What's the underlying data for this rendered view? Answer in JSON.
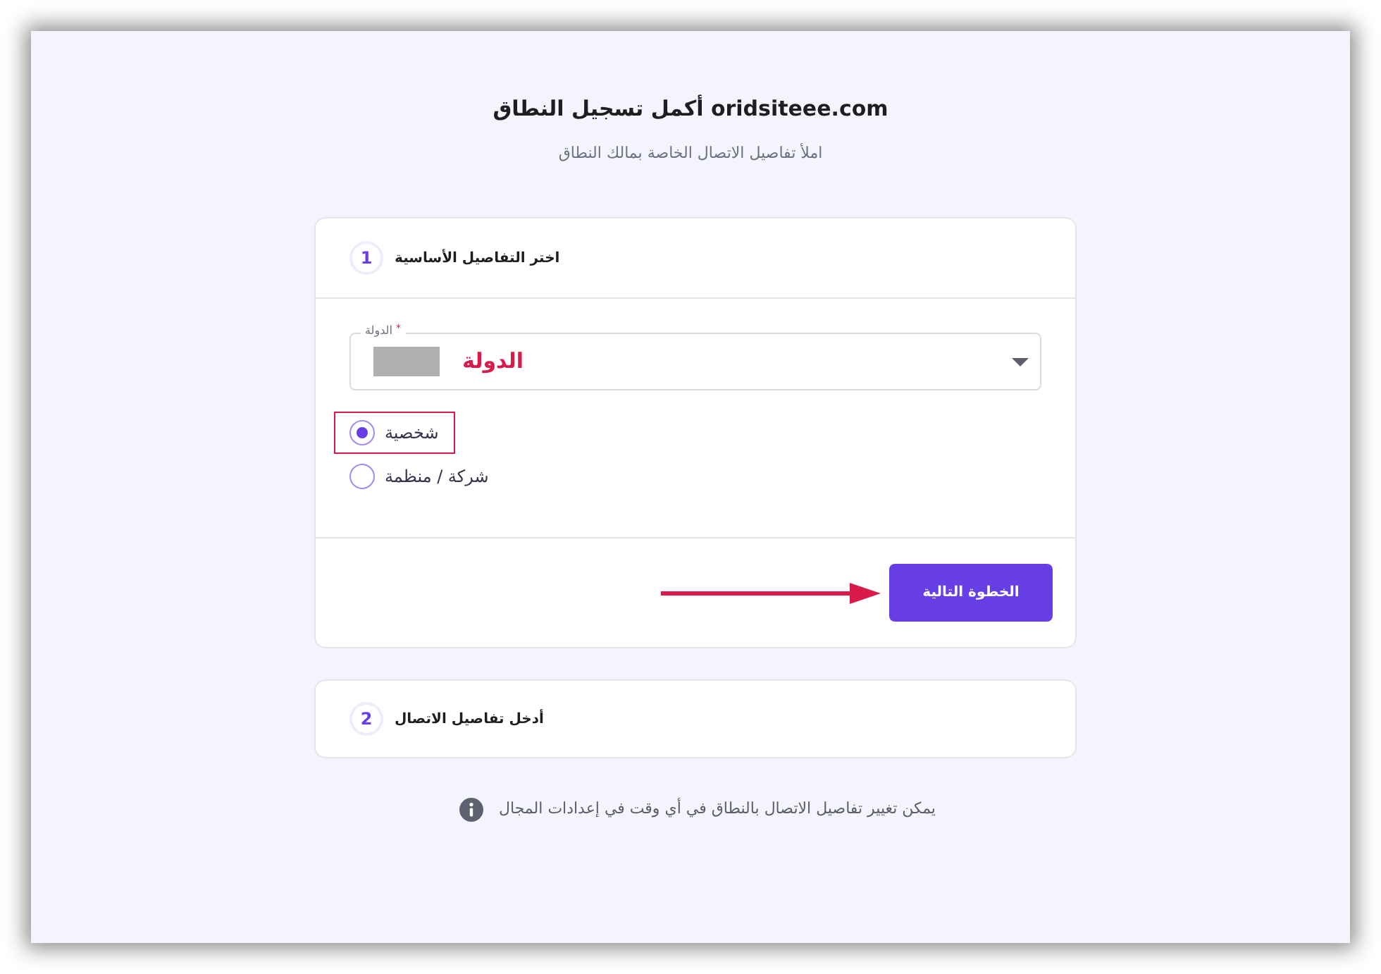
{
  "header": {
    "title": "أكمل تسجيل النطاق oridsiteee.com",
    "subtitle": "املأ تفاصيل الاتصال الخاصة بمالك النطاق"
  },
  "steps": [
    {
      "number": "1",
      "title": "اختر التفاصيل الأساسية",
      "expanded": true,
      "country_field": {
        "label": "الدولة",
        "required_mark": "*",
        "annotation": "الدولة"
      },
      "options": [
        {
          "label": "شخصية",
          "selected": true,
          "annotated": true
        },
        {
          "label": "شركة / منظمة",
          "selected": false,
          "annotated": false
        }
      ],
      "next_button": "الخطوة التالية"
    },
    {
      "number": "2",
      "title": "أدخل تفاصيل الاتصال",
      "expanded": false
    }
  ],
  "note": "يمكن تغيير تفاصيل الاتصال بالنطاق في أي وقت في إعدادات المجال"
}
